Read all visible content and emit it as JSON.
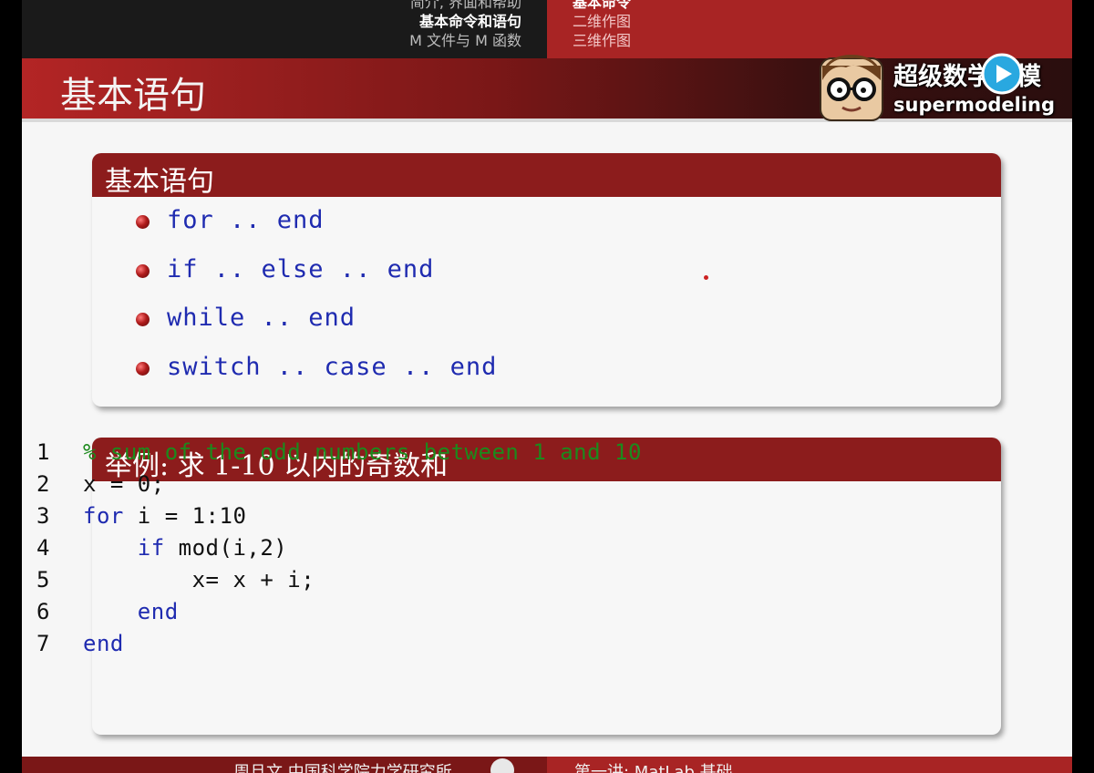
{
  "nav": {
    "left_items": [
      {
        "label": "简介, 界面和帮助"
      },
      {
        "label": "基本命令和语句"
      },
      {
        "label": "M 文件与 M 函数"
      }
    ],
    "right_items": [
      {
        "label": "基本命令"
      },
      {
        "label": "二维作图"
      },
      {
        "label": "三维作图"
      }
    ]
  },
  "logo": {
    "cn_text": "超级数学建模",
    "en_text": "supermodeling"
  },
  "frame": {
    "title": "基本语句"
  },
  "block1": {
    "title": "基本语句",
    "items": [
      {
        "text": "for .. end"
      },
      {
        "text": "if .. else .. end"
      },
      {
        "text": "while .. end"
      },
      {
        "text": "switch .. case .. end"
      }
    ]
  },
  "block2": {
    "title": "举例: 求 1-10 以内的奇数和",
    "lines": [
      {
        "num": "1",
        "text": "% sum of the odd numbers between 1 and 10"
      },
      {
        "num": "2",
        "text": "x = 0;"
      },
      {
        "num": "3",
        "text": "for i = 1:10"
      },
      {
        "num": "4",
        "text": "    if mod(i,2)"
      },
      {
        "num": "5",
        "text": "        x= x + i;"
      },
      {
        "num": "6",
        "text": "    end"
      },
      {
        "num": "7",
        "text": "end"
      }
    ]
  },
  "footer": {
    "left_text": "周旦文  中国科学院力学研究所",
    "right_text": "第一讲: MatLab 基础"
  },
  "colors": {
    "accent_red": "#8c1c1c",
    "keyword_blue": "#1f2bb0",
    "comment_green": "#1c8a1c"
  }
}
